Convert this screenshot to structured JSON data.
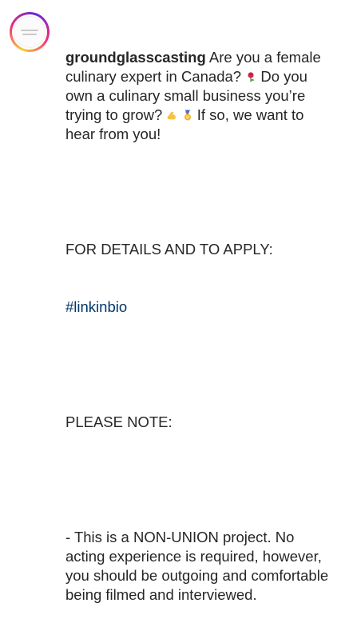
{
  "post": {
    "username": "groundglasscasting",
    "caption": {
      "intro": "Are you a female culinary expert in Canada? ",
      "intro_emoji": "rose-icon",
      "intro_2": " Do you own a culinary small business you’re trying to grow? ",
      "emoji_2": "flexed-biceps-icon",
      "emoji_3": "medal-icon",
      "intro_3": " If so, we want to hear from you!",
      "details_heading": "FOR DETAILS AND TO APPLY:",
      "hashtag": "#linkinbio",
      "note_heading": "PLEASE NOTE:",
      "note_body": "- This is a NON-UNION project. No acting experience is required, however, you should be outgoing and comfortable being filmed and interviewed."
    }
  },
  "colors": {
    "text": "#262626",
    "hashtag": "#00376b",
    "ring_start": "#f9ce34",
    "ring_mid": "#ee2a7b",
    "ring_end": "#6228d7"
  }
}
